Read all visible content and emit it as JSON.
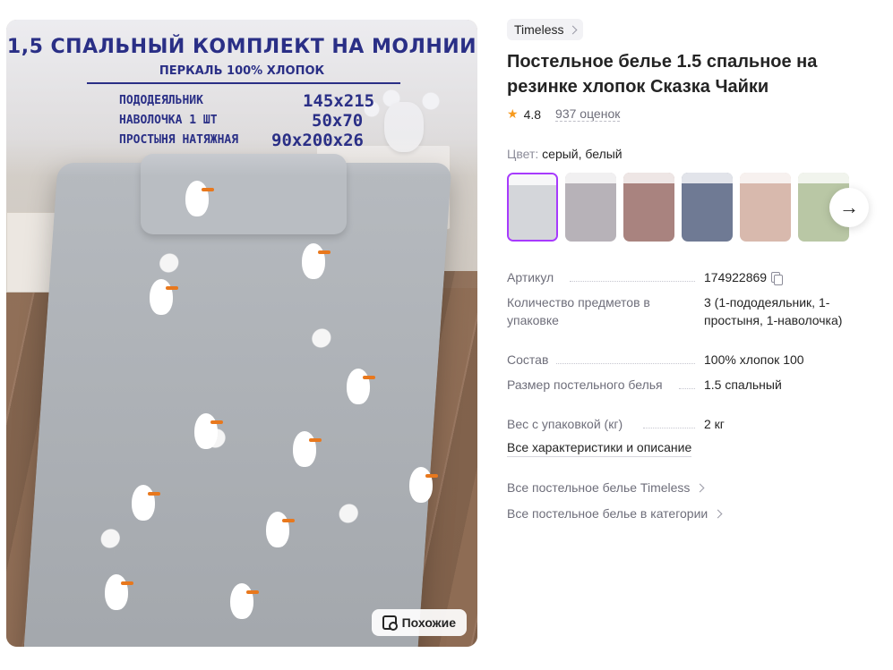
{
  "banner": {
    "title": "1,5 СПАЛЬНЫЙ  КОМПЛЕКТ  НА МОЛНИИ",
    "subtitle": "ПЕРКАЛЬ  100% ХЛОПОК",
    "rows": [
      {
        "label": "ПОДОДЕЯЛЬНИК",
        "value": "145x215"
      },
      {
        "label": "НАВОЛОЧКА  1 ШТ",
        "value": "50x70"
      },
      {
        "label": "ПРОСТЫНЯ НАТЯЖНАЯ",
        "value": "90x200x26"
      }
    ]
  },
  "similar_label": "Похожие",
  "brand": "Timeless",
  "title": "Постельное белье 1.5 спальное на резинке хлопок Сказка Чайки",
  "rating": "4.8",
  "reviews": "937 оценок",
  "color": {
    "label": "Цвет:",
    "value": "серый, белый"
  },
  "thumbnails": [
    {
      "name": "thumb-grey-seagulls",
      "bg": "#d4d6da"
    },
    {
      "name": "thumb-grey-floral",
      "bg": "#b7b2b8"
    },
    {
      "name": "thumb-red-floral",
      "bg": "#a9837f"
    },
    {
      "name": "thumb-blue-floral",
      "bg": "#6f7a94"
    },
    {
      "name": "thumb-pink-floral",
      "bg": "#d8b9ad"
    },
    {
      "name": "thumb-green-floral",
      "bg": "#b9c7a5"
    }
  ],
  "specs": [
    {
      "key": "Артикул",
      "value": "174922869"
    },
    {
      "key": "Количество предметов в упаковке",
      "value": "3 (1-пододеяльник, 1-простыня, 1-наволочка)"
    },
    {
      "key": "Состав",
      "value": "100% хлопок 100"
    },
    {
      "key": "Размер постельного белья",
      "value": "1.5 спальный"
    },
    {
      "key": "Вес с упаковкой (кг)",
      "value": "2 кг"
    }
  ],
  "all_specs_label": "Все характеристики и описание",
  "links": [
    "Все постельное белье Timeless",
    "Все постельное белье в категории"
  ],
  "colors": {
    "accent": "#a73afd",
    "star": "#f79a1e",
    "banner_text": "#2a2f86"
  }
}
